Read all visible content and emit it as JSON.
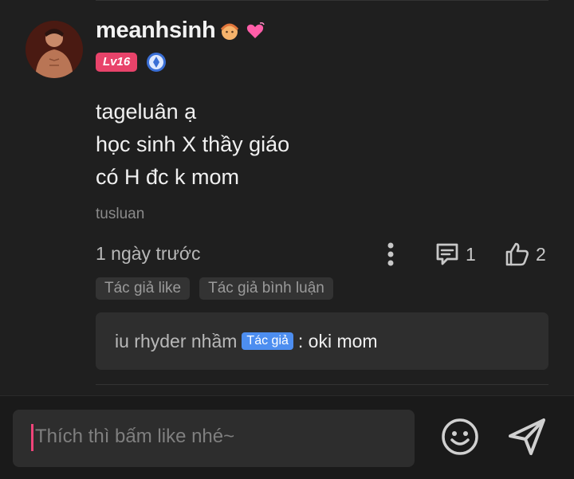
{
  "comment": {
    "username": "meanhsinh",
    "level": "Lv16",
    "content_lines": [
      "tageluân ạ",
      "học sinh X thầy giáo",
      "có H đc k mom"
    ],
    "tag": "tusluan",
    "time": "1 ngày trước",
    "comment_count": "1",
    "like_count": "2",
    "chips": [
      "Tác giả like",
      "Tác giả bình luận"
    ]
  },
  "reply": {
    "author": "iu rhyder nhầm",
    "author_badge": "Tác giả",
    "text": ": oki mom"
  },
  "input": {
    "placeholder": "Thích thì bấm like nhé~"
  },
  "colors": {
    "background": "#1f1f1f",
    "level_badge": "#e8436a",
    "author_badge": "#4d8ef0",
    "caret": "#f0447a"
  }
}
